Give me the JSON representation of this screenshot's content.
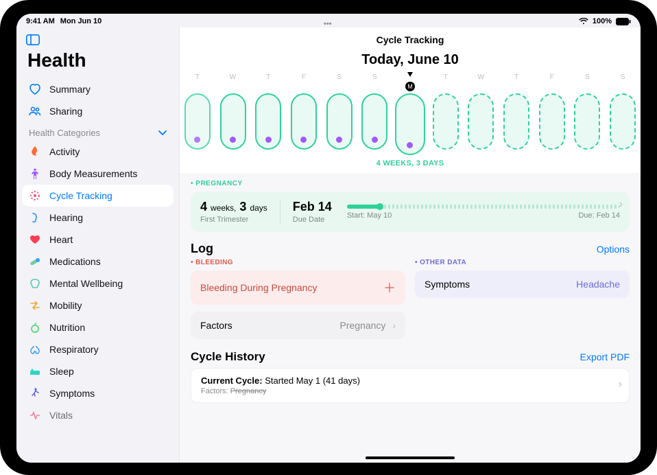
{
  "status": {
    "time": "9:41 AM",
    "date": "Mon Jun 10",
    "battery": "100%"
  },
  "sidebar": {
    "title": "Health",
    "summary": "Summary",
    "sharing": "Sharing",
    "categories_label": "Health Categories",
    "items": [
      {
        "label": "Activity"
      },
      {
        "label": "Body Measurements"
      },
      {
        "label": "Cycle Tracking"
      },
      {
        "label": "Hearing"
      },
      {
        "label": "Heart"
      },
      {
        "label": "Medications"
      },
      {
        "label": "Mental Wellbeing"
      },
      {
        "label": "Mobility"
      },
      {
        "label": "Nutrition"
      },
      {
        "label": "Respiratory"
      },
      {
        "label": "Sleep"
      },
      {
        "label": "Symptoms"
      },
      {
        "label": "Vitals"
      }
    ]
  },
  "main": {
    "title": "Cycle Tracking",
    "subtitle": "Today, June 10",
    "days": [
      "T",
      "W",
      "T",
      "F",
      "S",
      "S",
      "M",
      "T",
      "W",
      "T",
      "F",
      "S",
      "S"
    ],
    "today_initial": "M",
    "duration": "4 WEEKS, 3 DAYS"
  },
  "pregnancy": {
    "section": "PREGNANCY",
    "weeks_num": "4",
    "weeks_unit": "weeks,",
    "days_num": "3",
    "days_unit": "days",
    "trimester": "First Trimester",
    "due_date": "Feb 14",
    "due_label": "Due Date",
    "start_label": "Start: May 10",
    "due_end_label": "Due: Feb 14"
  },
  "log": {
    "heading": "Log",
    "options": "Options",
    "bleeding_section": "BLEEDING",
    "bleeding_label": "Bleeding During Pregnancy",
    "other_section": "OTHER DATA",
    "symptoms_label": "Symptoms",
    "symptoms_value": "Headache",
    "factors_label": "Factors",
    "factors_value": "Pregnancy"
  },
  "history": {
    "heading": "Cycle History",
    "export": "Export PDF",
    "current_bold": "Current Cycle:",
    "current_rest": " Started May 1 (41 days)",
    "factors_label": "Factors: ",
    "factors_value": "Pregnancy"
  }
}
